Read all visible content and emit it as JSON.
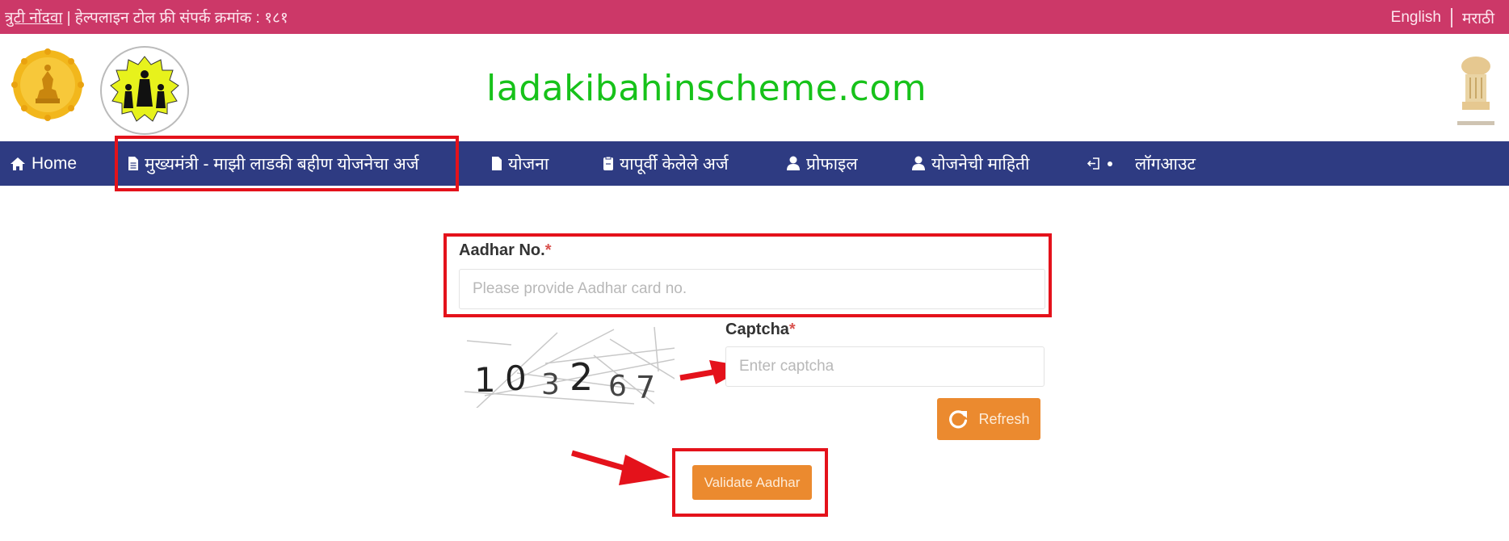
{
  "topbar": {
    "report_error_link": "त्रुटी नोंदवा",
    "helpline_text": " | हेल्पलाइन टोल फ्री संपर्क क्रमांक : १८१",
    "lang_english": "English",
    "lang_marathi": "मराठी"
  },
  "header": {
    "brand_text": "ladakibahinscheme.com",
    "brand_color": "#17c21a",
    "logos": [
      "maharashtra-govt-emblem",
      "women-child-development-logo",
      "national-emblem-of-india"
    ]
  },
  "nav": {
    "items": [
      {
        "label": "Home",
        "icon": "home-icon"
      },
      {
        "label": "मुख्यमंत्री - माझी लाडकी बहीण योजनेचा अर्ज",
        "icon": "document-icon",
        "highlighted": true
      },
      {
        "label": "योजना",
        "icon": "document-icon"
      },
      {
        "label": "यापूर्वी केलेले अर्ज",
        "icon": "clipboard-icon"
      },
      {
        "label": "प्रोफाइल",
        "icon": "user-icon"
      },
      {
        "label": "योजनेची माहिती",
        "icon": "user-icon"
      },
      {
        "label": "लॉगआउट",
        "icon": "logout-icon"
      }
    ],
    "bg_color": "#2e3b82"
  },
  "form": {
    "aadhar": {
      "label": "Aadhar No.",
      "required_mark": "*",
      "value": "",
      "placeholder": "Please provide Aadhar card no."
    },
    "captcha": {
      "label": "Captcha",
      "required_mark": "*",
      "value": "",
      "placeholder": "Enter captcha",
      "image_digits": [
        "1",
        "0",
        "3",
        "2",
        "6",
        "7"
      ]
    },
    "refresh_label": "Refresh",
    "validate_label": "Validate Aadhar",
    "button_color": "#eb8a2f"
  },
  "annotations": {
    "highlight_color": "#e4121b"
  }
}
